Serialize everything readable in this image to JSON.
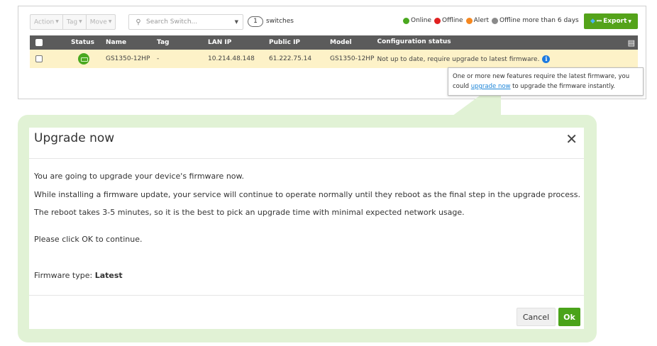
{
  "toolbar": {
    "action_label": "Action",
    "tag_label": "Tag",
    "move_label": "Move",
    "search_placeholder": "Search Switch...",
    "switch_count": "1",
    "switch_count_label": "switches",
    "legend": [
      {
        "label": "Online",
        "color": "#4aa81f"
      },
      {
        "label": "Offline",
        "color": "#e02020"
      },
      {
        "label": "Alert",
        "color": "#f5871f"
      },
      {
        "label": "Offline more than 6 days",
        "color": "#8a8a8a"
      }
    ],
    "export_label": "Export"
  },
  "table": {
    "columns": [
      "Status",
      "Name",
      "Tag",
      "LAN IP",
      "Public IP",
      "Model",
      "Configuration status"
    ],
    "rows": [
      {
        "status": "online",
        "name": "GS1350-12HP",
        "tag": "-",
        "lan_ip": "10.214.48.148",
        "public_ip": "61.222.75.14",
        "model": "GS1350-12HP",
        "config_status": "Not up to date, require upgrade to latest firmware."
      }
    ]
  },
  "tooltip": {
    "text_before": "One or more new features require the latest firmware, you could ",
    "link": "upgrade now",
    "text_after": " to upgrade the firmware instantly."
  },
  "modal": {
    "title": "Upgrade now",
    "line1": "You are going to upgrade your device's firmware now.",
    "line2": "While installing a firmware update, your service will continue to operate normally until they reboot as the final step in the upgrade process.",
    "line3": "The reboot takes 3-5 minutes, so it is the best to pick an upgrade time with minimal expected network usage.",
    "line4": "Please click OK to continue.",
    "firmware_label": "Firmware type: ",
    "firmware_value": "Latest",
    "cancel_label": "Cancel",
    "ok_label": "Ok"
  },
  "colors": {
    "accent_green": "#4aa31a",
    "row_highlight": "#fdf2c8",
    "header_bg": "#5b5b5b",
    "callout_bg": "#e1f2d5",
    "link": "#1d85d8"
  }
}
